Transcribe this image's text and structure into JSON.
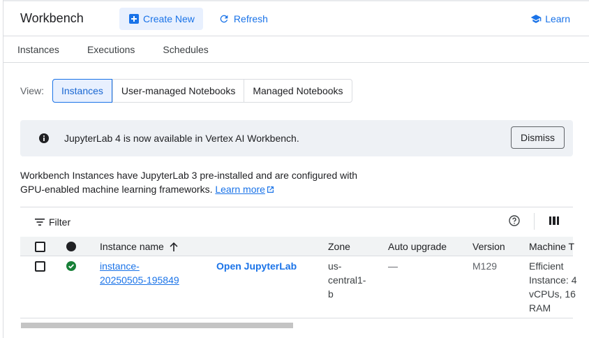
{
  "header": {
    "title": "Workbench",
    "create_label": "Create New",
    "refresh_label": "Refresh",
    "learn_label": "Learn"
  },
  "tabs": [
    {
      "label": "Instances"
    },
    {
      "label": "Executions"
    },
    {
      "label": "Schedules"
    }
  ],
  "view": {
    "label": "View:",
    "options": [
      {
        "label": "Instances",
        "selected": true
      },
      {
        "label": "User-managed Notebooks",
        "selected": false
      },
      {
        "label": "Managed Notebooks",
        "selected": false
      }
    ]
  },
  "banner": {
    "icon": "info-icon",
    "text": "JupyterLab 4 is now available in Vertex AI Workbench.",
    "dismiss_label": "Dismiss"
  },
  "description": {
    "line1": "Workbench Instances have JupyterLab 3 pre-installed and are configured with",
    "line2": "GPU-enabled machine learning frameworks.",
    "learn_more": "Learn more"
  },
  "table": {
    "filter_label": "Filter",
    "columns": {
      "name": "Instance name",
      "zone": "Zone",
      "auto_upgrade": "Auto upgrade",
      "version": "Version",
      "machine_type": "Machine T"
    },
    "rows": [
      {
        "name_line1": "instance-",
        "name_line2": "20250505-195849",
        "action": "Open JupyterLab",
        "zone_line1": "us-",
        "zone_line2": "central1-",
        "zone_line3": "b",
        "auto_upgrade": "—",
        "version": "M129",
        "machine_line1": "Efficient",
        "machine_line2": "Instance: 4",
        "machine_line3": "vCPUs, 16",
        "machine_line4": "RAM",
        "status": "running"
      }
    ]
  },
  "colors": {
    "accent": "#1a73e8",
    "status_ok": "#188038",
    "banner_bg": "#eef1f5"
  }
}
